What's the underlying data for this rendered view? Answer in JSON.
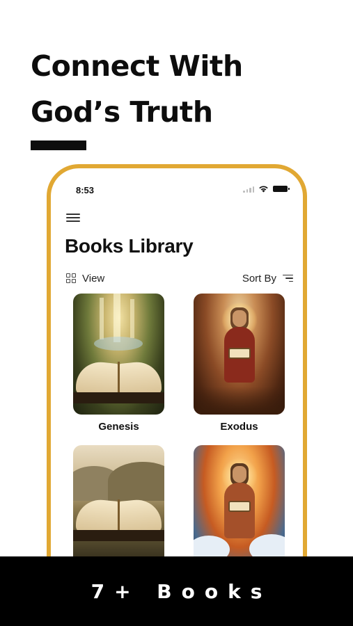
{
  "headline": {
    "line1": "Connect With",
    "line2": "God’s Truth"
  },
  "colors": {
    "frame_gold": "#e1a833",
    "banner_bg": "#000000",
    "text_dark": "#111111"
  },
  "status_bar": {
    "time": "8:53",
    "icons": [
      "signal-icon",
      "wifi-icon",
      "battery-icon"
    ]
  },
  "app": {
    "menu_icon": "hamburger-menu-icon",
    "title": "Books Library",
    "toolbar": {
      "view_label": "View",
      "view_icon": "grid-view-icon",
      "sort_label": "Sort By",
      "sort_icon": "sort-lines-icon"
    },
    "books": [
      {
        "label": "Genesis",
        "cover": "open-bible-in-forest"
      },
      {
        "label": "Exodus",
        "cover": "bearded-prophet-reading"
      },
      {
        "label": "",
        "cover": "open-book-over-landscape"
      },
      {
        "label": "",
        "cover": "prophet-holding-book-sunburst"
      }
    ]
  },
  "banner": {
    "text": "7+ Books"
  }
}
